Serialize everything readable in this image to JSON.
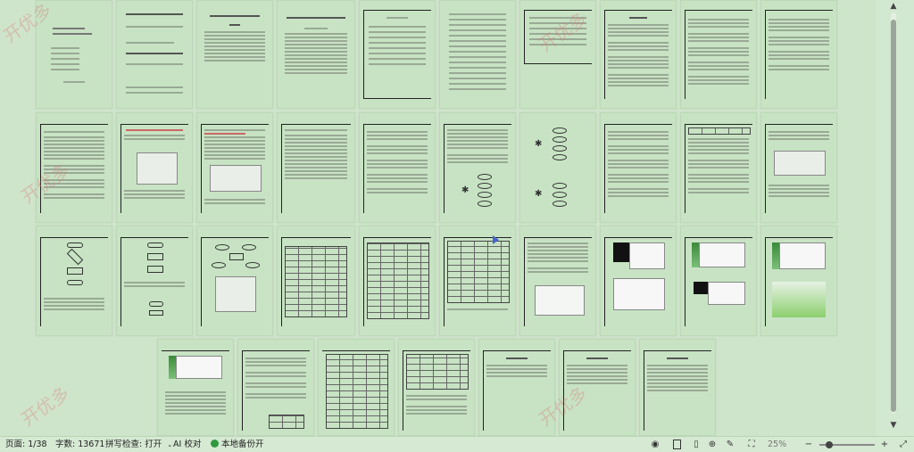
{
  "status_bar": {
    "page": "页面: 1/38",
    "word_count": "字数: 13671",
    "spell_check": "拼写检查: 打开",
    "ai_proof": "AI 校对",
    "backup": "本地备份开",
    "zoom": "25%"
  },
  "watermark": {
    "text": "开优多"
  },
  "icons": {
    "eye": "eye-icon",
    "page_view": "page-view-icon",
    "read_mode": "read-mode-icon",
    "web": "globe-icon",
    "pen": "pen-icon",
    "fit": "fit-screen-icon",
    "zoom_out": "minus-icon",
    "zoom_in": "plus-icon",
    "fullscreen": "fullscreen-icon"
  },
  "colors": {
    "background": "#cfe5cb",
    "page": "#c7e3c3",
    "backup_dot": "#2e9a3e"
  }
}
